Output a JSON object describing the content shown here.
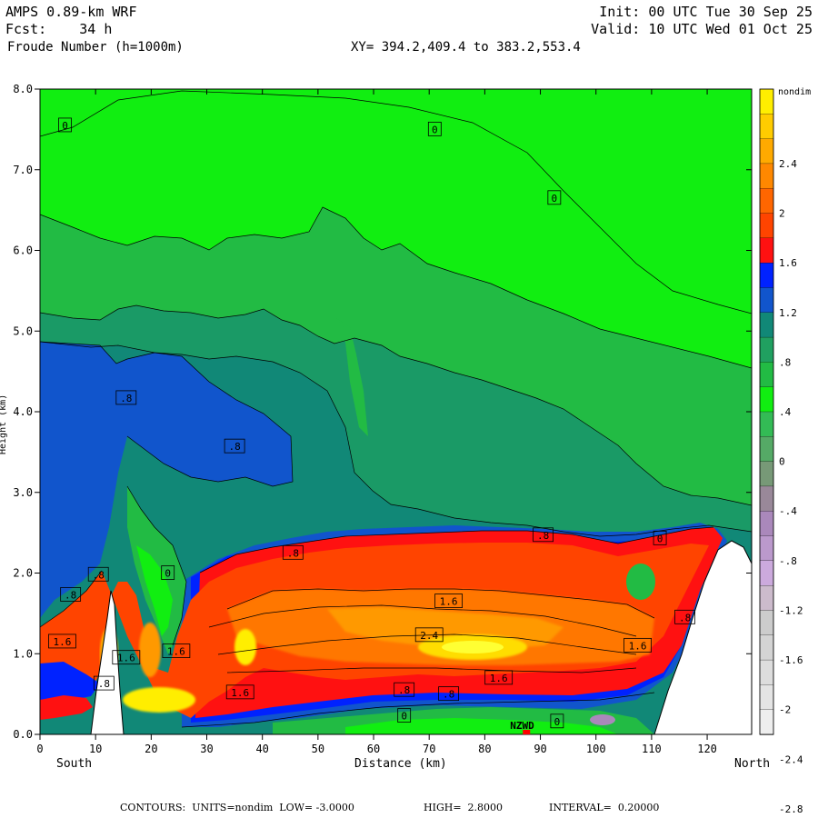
{
  "header": {
    "model": "AMPS 0.89-km WRF",
    "fcst": "Fcst:    34 h",
    "field": "Froude Number (h=1000m)",
    "init": "Init: 00 UTC Tue 30 Sep 25",
    "valid": "Valid: 10 UTC Wed 01 Oct 25",
    "xy": "XY= 394.2,409.4 to 383.2,553.4"
  },
  "footer": {
    "contours": "CONTOURS:  UNITS=nondim  LOW= -3.0000",
    "high": "HIGH=  2.8000",
    "interval": "INTERVAL=  0.20000"
  },
  "colors": {
    "green_bright": "#11ee11",
    "green_mid": "#22bb44",
    "green_dark": "#20a060",
    "teal": "#118877",
    "blue_dark": "#1155cc",
    "blue": "#0022ff",
    "red": "#ff1111",
    "orange_red": "#ff4400",
    "orange": "#ff7700",
    "yellow": "#ffee00",
    "terrain": "#ffffff"
  },
  "chart_data": {
    "type": "contour",
    "title": "Froude Number (h=1000m)",
    "xlabel": "Distance (km)",
    "ylabel": "Height (km)",
    "x_left_label": "South",
    "x_right_label": "North",
    "xlim": [
      0,
      128
    ],
    "ylim": [
      0,
      8
    ],
    "x_ticks": [
      0,
      10,
      20,
      30,
      40,
      50,
      60,
      70,
      80,
      90,
      100,
      110,
      120
    ],
    "y_ticks": [
      "0.0",
      "1.0",
      "2.0",
      "3.0",
      "4.0",
      "5.0",
      "6.0",
      "7.0",
      "8.0"
    ],
    "units": "nondim",
    "contour_low": -3.0,
    "contour_high": 2.8,
    "contour_interval": 0.2,
    "station_label": "NZWD",
    "station_x_km": 87.5,
    "colorbar": {
      "unit_label": "nondim",
      "labels": [
        "2.4",
        "2",
        "1.6",
        "1.2",
        ".8",
        ".4",
        "0",
        "-.4",
        "-.8",
        "-1.2",
        "-1.6",
        "-2",
        "-2.4",
        "-2.8"
      ],
      "swatches": [
        "#ffee00",
        "#ffcc00",
        "#ffaa00",
        "#ff8800",
        "#ff6600",
        "#ff4400",
        "#ff1111",
        "#0022ff",
        "#1155cc",
        "#118877",
        "#20a060",
        "#22bb44",
        "#11ee11",
        "#33bb55",
        "#55aa66",
        "#779977",
        "#998899",
        "#aa88bb",
        "#bb99cc",
        "#ccaadd",
        "#ccbbcc",
        "#cccccc",
        "#d4d4d4",
        "#dddddd",
        "#e4e4e4",
        "#eeeeee"
      ]
    },
    "contour_labels": [
      {
        "x": 4.5,
        "y": 7.55,
        "text": "0"
      },
      {
        "x": 71,
        "y": 7.5,
        "text": "0"
      },
      {
        "x": 92.5,
        "y": 6.65,
        "text": "0"
      },
      {
        "x": 15.5,
        "y": 4.17,
        "text": ".8"
      },
      {
        "x": 35,
        "y": 3.57,
        "text": ".8"
      },
      {
        "x": 23,
        "y": 2.0,
        "text": "0"
      },
      {
        "x": 45.5,
        "y": 2.25,
        "text": ".8"
      },
      {
        "x": 90.5,
        "y": 2.47,
        "text": ".8"
      },
      {
        "x": 111.5,
        "y": 2.43,
        "text": "0"
      },
      {
        "x": 10.5,
        "y": 1.98,
        "text": ".8"
      },
      {
        "x": 5.5,
        "y": 1.73,
        "text": ".8"
      },
      {
        "x": 73.5,
        "y": 1.65,
        "text": "1.6"
      },
      {
        "x": 116,
        "y": 1.45,
        "text": ".8"
      },
      {
        "x": 4,
        "y": 1.15,
        "text": "1.6"
      },
      {
        "x": 70,
        "y": 1.23,
        "text": "2.4"
      },
      {
        "x": 107.5,
        "y": 1.1,
        "text": "1.6"
      },
      {
        "x": 15.5,
        "y": 0.95,
        "text": "1.6"
      },
      {
        "x": 24.5,
        "y": 1.03,
        "text": "1.6"
      },
      {
        "x": 82.5,
        "y": 0.7,
        "text": "1.6"
      },
      {
        "x": 11.5,
        "y": 0.63,
        "text": ".8"
      },
      {
        "x": 36,
        "y": 0.52,
        "text": "1.6"
      },
      {
        "x": 65.5,
        "y": 0.55,
        "text": ".8"
      },
      {
        "x": 73.5,
        "y": 0.5,
        "text": ".8"
      },
      {
        "x": 65.5,
        "y": 0.23,
        "text": "0"
      },
      {
        "x": 93,
        "y": 0.16,
        "text": "0"
      }
    ]
  }
}
